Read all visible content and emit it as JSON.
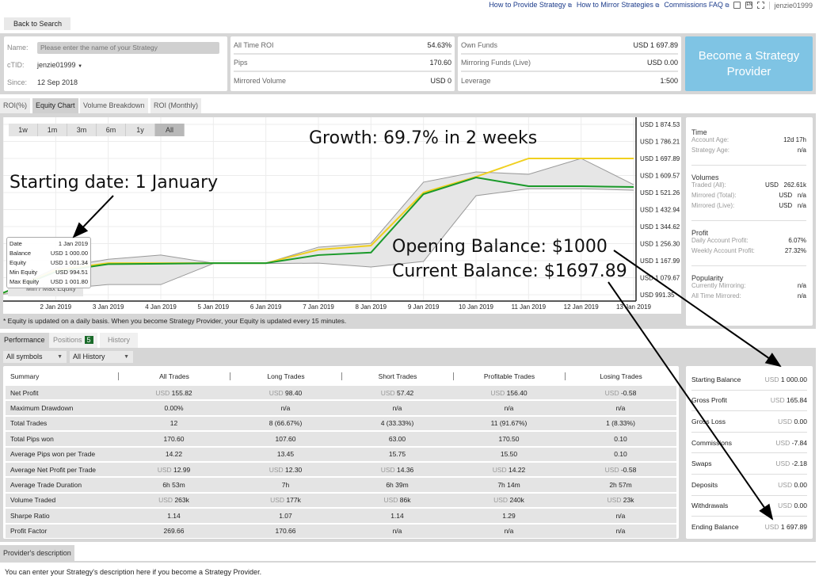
{
  "top_links": {
    "provide": "How to Provide Strategy",
    "mirror": "How to Mirror Strategies",
    "faq": "Commissions FAQ",
    "lang": "EN",
    "user": "jenzie01999"
  },
  "back": "Back to Search",
  "profile": {
    "name_label": "Name:",
    "name_placeholder": "Please enter the name of your Strategy",
    "ctid_label": "cTID:",
    "ctid": "jenzie01999",
    "since_label": "Since:",
    "since": "12 Sep 2018"
  },
  "stats": [
    {
      "label": "All Time ROI",
      "value": "54.63%"
    },
    {
      "label": "Pips",
      "value": "170.60"
    },
    {
      "label": "Mirrored Volume",
      "value": "USD 0"
    }
  ],
  "funds": [
    {
      "label": "Own Funds",
      "value": "USD 1 697.89"
    },
    {
      "label": "Mirroring Funds (Live)",
      "value": "USD 0.00"
    },
    {
      "label": "Leverage",
      "value": "1:500"
    }
  ],
  "become_button": "Become a Strategy Provider",
  "chart_tabs": [
    "ROI(%)",
    "Equity Chart",
    "Volume Breakdown",
    "ROI (Monthly)"
  ],
  "ranges": [
    "1w",
    "1m",
    "3m",
    "6m",
    "1y",
    "All"
  ],
  "tooltip": [
    [
      "Date",
      "1 Jan 2019"
    ],
    [
      "Balance",
      "USD 1 000.00"
    ],
    [
      "Equity",
      "USD 1 001.34"
    ],
    [
      "Min Equity",
      "USD 994.51"
    ],
    [
      "Max Equity",
      "USD 1 001.80"
    ]
  ],
  "legend": {
    "balance": "Balance",
    "equity": "Equity",
    "minmax": "Min / Max Equity"
  },
  "footnote": "* Equity is updated on a daily basis. When you become Strategy Provider, your Equity is updated every 15 minutes.",
  "colors": {
    "balance": "#f0d020",
    "equity": "#1a9a2a",
    "minmax": "#999999",
    "accent": "#7fc4e4"
  },
  "chart_data": {
    "type": "line",
    "x": [
      "1 Jan 2019",
      "2 Jan 2019",
      "3 Jan 2019",
      "4 Jan 2019",
      "5 Jan 2019",
      "6 Jan 2019",
      "7 Jan 2019",
      "8 Jan 2019",
      "9 Jan 2019",
      "10 Jan 2019",
      "11 Jan 2019",
      "12 Jan 2019",
      "13 Jan 2019"
    ],
    "x_tick_labels": [
      "2 Jan 2019",
      "3 Jan 2019",
      "4 Jan 2019",
      "5 Jan 2019",
      "6 Jan 2019",
      "7 Jan 2019",
      "8 Jan 2019",
      "9 Jan 2019",
      "10 Jan 2019",
      "11 Jan 2019",
      "12 Jan 2019",
      "13 Jan 2019"
    ],
    "y_tick_labels": [
      "USD 1 874.53",
      "USD 1 786.21",
      "USD 1 697.89",
      "USD 1 609.57",
      "USD 1 521.26",
      "USD 1 432.94",
      "USD 1 344.62",
      "USD 1 256.30",
      "USD 1 167.99",
      "USD 1 079.67",
      "USD 991.35"
    ],
    "ylim": [
      991.35,
      1874.53
    ],
    "grid": true,
    "y_axis": "right",
    "series": [
      {
        "name": "Balance",
        "values": [
          1000,
          1120,
          1155,
          1155,
          1155,
          1155,
          1225,
          1246,
          1521,
          1603,
          1698,
          1698,
          1698
        ]
      },
      {
        "name": "Equity",
        "values": [
          1001.34,
          1110,
          1150,
          1152,
          1155,
          1155,
          1197,
          1210,
          1513,
          1599,
          1554,
          1554,
          1550
        ]
      },
      {
        "name": "Min Equity",
        "values": [
          994.51,
          1020,
          1044,
          1044,
          1153,
          1153,
          1155,
          1135,
          1164,
          1505,
          1541,
          1541,
          1533
        ]
      },
      {
        "name": "Max Equity",
        "values": [
          1001.8,
          1130,
          1175,
          1197,
          1155,
          1155,
          1238,
          1258,
          1575,
          1628,
          1616,
          1698,
          1562
        ]
      }
    ]
  },
  "info": {
    "time": "Time",
    "account_age_label": "Account Age:",
    "account_age": "12d 17h",
    "strategy_age_label": "Strategy Age:",
    "strategy_age": "n/a",
    "volumes": "Volumes",
    "traded_label": "Traded (All):",
    "traded": "USD   262.61k",
    "mirrored_total_label": "Mirrored (Total):",
    "mirrored_total": "USD   n/a",
    "mirrored_live_label": "Mirrored (Live):",
    "mirrored_live": "USD   n/a",
    "profit": "Profit",
    "daily_label": "Daily Account Profit:",
    "daily": "6.07%",
    "weekly_label": "Weekly Account Profit:",
    "weekly": "27.32%",
    "popularity": "Popularity",
    "current_label": "Currently Mirroring:",
    "current": "n/a",
    "alltime_label": "All Time Mirrored:",
    "alltime": "n/a"
  },
  "perf_tabs": {
    "performance": "Performance",
    "positions": "Positions",
    "positions_count": "5",
    "history": "History"
  },
  "filters": {
    "symbols": "All symbols",
    "history": "All History"
  },
  "table": {
    "headers": [
      "Summary",
      "All Trades",
      "Long Trades",
      "Short Trades",
      "Profitable Trades",
      "Losing Trades"
    ],
    "rows": [
      [
        "Net Profit",
        "USD 155.82",
        "USD 98.40",
        "USD 57.42",
        "USD 156.40",
        "USD -0.58"
      ],
      [
        "Maximum Drawdown",
        "0.00%",
        "n/a",
        "n/a",
        "n/a",
        "n/a"
      ],
      [
        "Total Trades",
        "12",
        "8 (66.67%)",
        "4 (33.33%)",
        "11 (91.67%)",
        "1 (8.33%)"
      ],
      [
        "Total Pips won",
        "170.60",
        "107.60",
        "63.00",
        "170.50",
        "0.10"
      ],
      [
        "Average Pips won per Trade",
        "14.22",
        "13.45",
        "15.75",
        "15.50",
        "0.10"
      ],
      [
        "Average Net Profit per Trade",
        "USD 12.99",
        "USD 12.30",
        "USD 14.36",
        "USD 14.22",
        "USD -0.58"
      ],
      [
        "Average Trade Duration",
        "6h 53m",
        "7h",
        "6h 39m",
        "7h 14m",
        "2h 57m"
      ],
      [
        "Volume Traded",
        "USD 263k",
        "USD 177k",
        "USD 86k",
        "USD 240k",
        "USD 23k"
      ],
      [
        "Sharpe Ratio",
        "1.14",
        "1.07",
        "1.14",
        "1.29",
        "n/a"
      ],
      [
        "Profit Factor",
        "269.66",
        "170.66",
        "n/a",
        "n/a",
        "n/a"
      ]
    ]
  },
  "summary": [
    [
      "Starting Balance",
      "USD 1 000.00"
    ],
    [
      "Gross Profit",
      "USD 165.84"
    ],
    [
      "Gross Loss",
      "USD 0.00"
    ],
    [
      "Commissions",
      "USD -7.84"
    ],
    [
      "Swaps",
      "USD -2.18"
    ],
    [
      "Deposits",
      "USD 0.00"
    ],
    [
      "Withdrawals",
      "USD 0.00"
    ],
    [
      "Ending Balance",
      "USD 1 697.89"
    ]
  ],
  "description": {
    "tab": "Provider's description",
    "text": "You can enter your Strategy's description here if you become a Strategy Provider."
  },
  "annotations": {
    "growth": "Growth: 69.7% in 2 weeks",
    "start": "Starting date: 1 January",
    "opening": "Opening Balance: $1000",
    "current": "Current Balance: $1697.89"
  }
}
